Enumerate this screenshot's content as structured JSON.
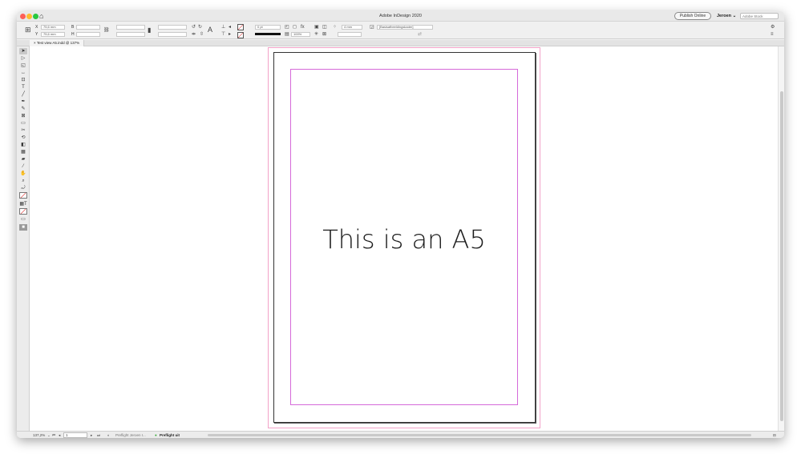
{
  "window": {
    "title": "Adobe InDesign 2020",
    "traffic_colors": {
      "close": "#fe5f57",
      "minimize": "#febc2e",
      "zoom": "#28c840"
    }
  },
  "titlebar": {
    "home_icon": "home-icon",
    "publish_label": "Publish Online",
    "user_name": "Jeroen",
    "search_placeholder": "Adobe Stock"
  },
  "control": {
    "x_label": "X",
    "x_value": "75,6 mm",
    "y_label": "Y",
    "y_value": "75,6 mm",
    "w_label": "B",
    "h_label": "H",
    "stroke_weight": "0 pt",
    "scale": "100%",
    "gap": "4 mm",
    "object_style": "[Basisafbeeldingskader]"
  },
  "tabs": [
    {
      "close": "×",
      "label": "Test view A5.indd @ 137%"
    }
  ],
  "document": {
    "text": "This is an A5",
    "colors": {
      "bleed": "#f3a2c8",
      "margin": "#d569d9"
    }
  },
  "status": {
    "zoom": "137,2%",
    "page": "1",
    "profile": "Preflight Jeroen I...",
    "preflight": "Preflight uit"
  }
}
